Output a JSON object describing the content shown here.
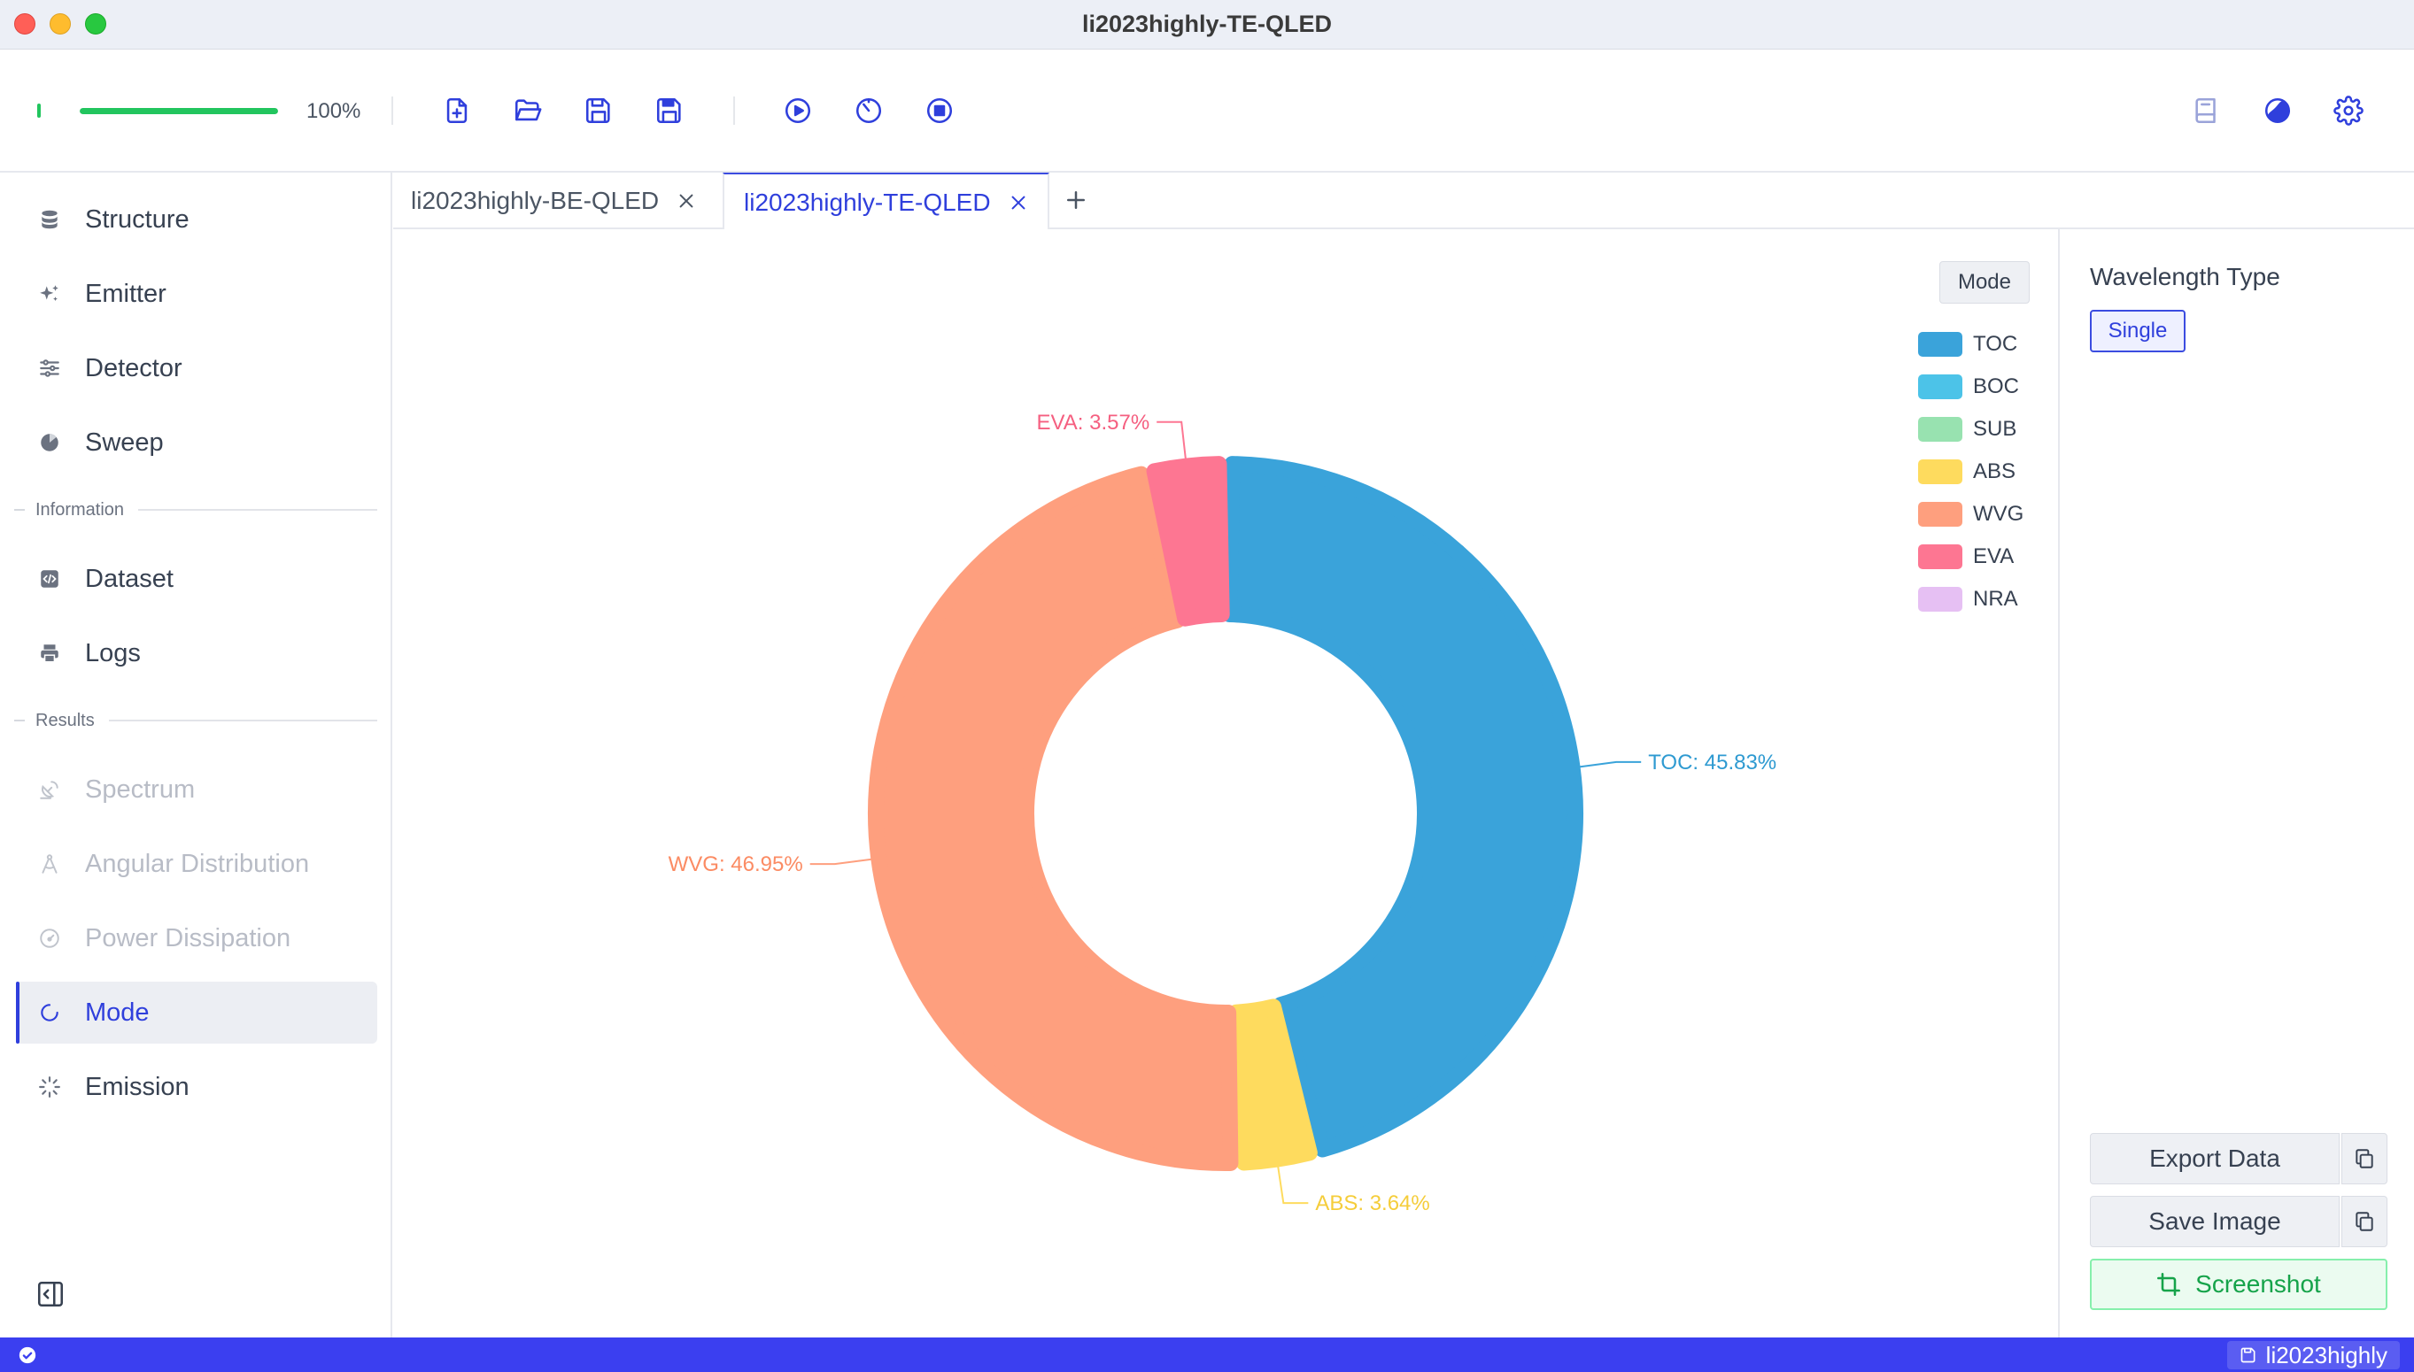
{
  "window": {
    "title": "li2023highly-TE-QLED"
  },
  "toolbar": {
    "progress_value": 1.0,
    "progress_label": "100%",
    "icons": [
      "new-file-icon",
      "open-folder-icon",
      "save-icon",
      "save-as-icon",
      "run-icon",
      "timer-icon",
      "stop-icon",
      "book-icon",
      "theme-icon",
      "settings-icon"
    ]
  },
  "sidebar": {
    "items": [
      {
        "label": "Structure",
        "icon": "database-icon"
      },
      {
        "label": "Emitter",
        "icon": "sparkles-icon"
      },
      {
        "label": "Detector",
        "icon": "sliders-icon"
      },
      {
        "label": "Sweep",
        "icon": "pie-icon"
      }
    ],
    "information_header": "Information",
    "information_items": [
      {
        "label": "Dataset",
        "icon": "code-file-icon"
      },
      {
        "label": "Logs",
        "icon": "printer-icon"
      }
    ],
    "results_header": "Results",
    "results_items": [
      {
        "label": "Spectrum",
        "icon": "satellite-icon",
        "disabled": true
      },
      {
        "label": "Angular Distribution",
        "icon": "compass-icon",
        "disabled": true
      },
      {
        "label": "Power Dissipation",
        "icon": "gauge-icon",
        "disabled": true
      },
      {
        "label": "Mode",
        "icon": "circle-notch-icon",
        "active": true
      },
      {
        "label": "Emission",
        "icon": "burst-icon"
      }
    ]
  },
  "tabs": [
    {
      "label": "li2023highly-BE-QLED",
      "active": false
    },
    {
      "label": "li2023highly-TE-QLED",
      "active": true
    }
  ],
  "chart": {
    "mode_button": "Mode",
    "legend": [
      {
        "name": "TOC",
        "color": "#3aa3da"
      },
      {
        "name": "BOC",
        "color": "#4cc3e8"
      },
      {
        "name": "SUB",
        "color": "#98e2b0"
      },
      {
        "name": "ABS",
        "color": "#fedb5e"
      },
      {
        "name": "WVG",
        "color": "#fe9f7e"
      },
      {
        "name": "EVA",
        "color": "#fd7692"
      },
      {
        "name": "NRA",
        "color": "#e6c0f3"
      }
    ]
  },
  "chart_data": {
    "type": "pie",
    "variant": "donut",
    "slices": [
      {
        "name": "TOC",
        "value": 45.83,
        "label": "TOC: 45.83%",
        "color": "#3aa3da",
        "label_color": "#2e9ad1"
      },
      {
        "name": "ABS",
        "value": 3.64,
        "label": "ABS: 3.64%",
        "color": "#fedb5e",
        "label_color": "#f5cd3a"
      },
      {
        "name": "WVG",
        "value": 46.95,
        "label": "WVG: 46.95%",
        "color": "#fe9f7e",
        "label_color": "#fb8b63"
      },
      {
        "name": "EVA",
        "value": 3.57,
        "label": "EVA: 3.57%",
        "color": "#fd7692",
        "label_color": "#f55f80"
      }
    ],
    "legend_position": "top-right"
  },
  "right_panel": {
    "wavelength_title": "Wavelength Type",
    "single_label": "Single",
    "export_label": "Export Data",
    "save_image_label": "Save Image",
    "screenshot_label": "Screenshot"
  },
  "statusbar": {
    "project": "li2023highly"
  }
}
